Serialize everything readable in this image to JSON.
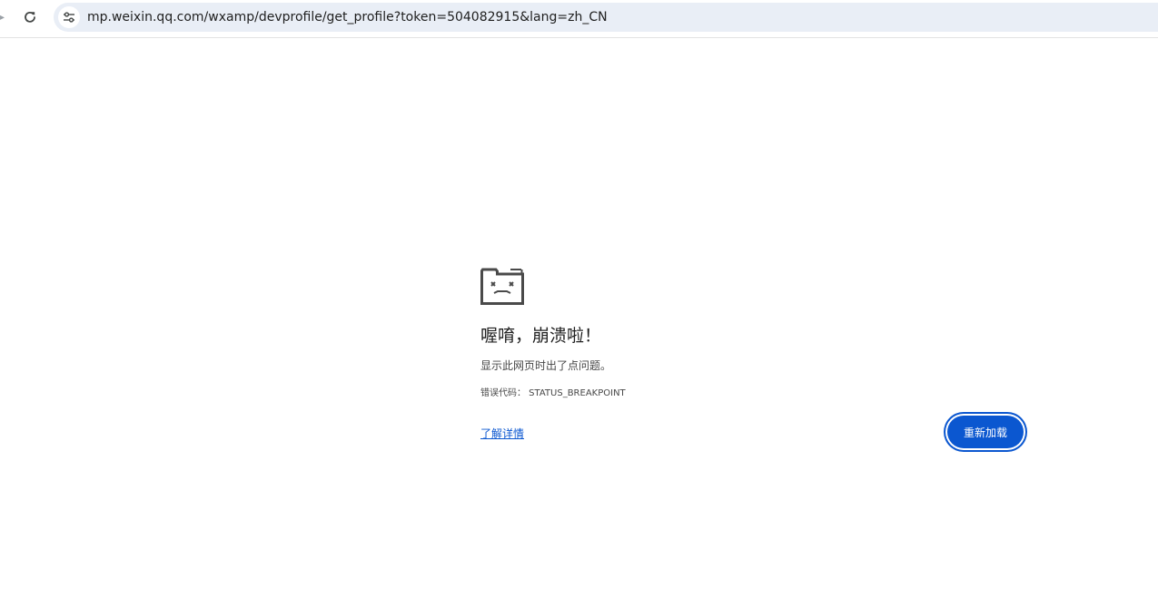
{
  "browser": {
    "url": "mp.weixin.qq.com/wxamp/devprofile/get_profile?token=504082915&lang=zh_CN",
    "forward_glyph": "▸"
  },
  "icons": {
    "reload": "reload-icon",
    "site_info": "tune-icon",
    "sad_tab": "sad-folder-icon"
  },
  "error": {
    "title": "喔唷，崩溃啦！",
    "description": "显示此网页时出了点问题。",
    "code_line": "错误代码：  STATUS_BREAKPOINT",
    "learn_more": "了解详情",
    "reload_button": "重新加载"
  },
  "colors": {
    "accent": "#0b57d0",
    "omnibox_bg": "#e9eef6",
    "text": "#1f1f1f"
  }
}
